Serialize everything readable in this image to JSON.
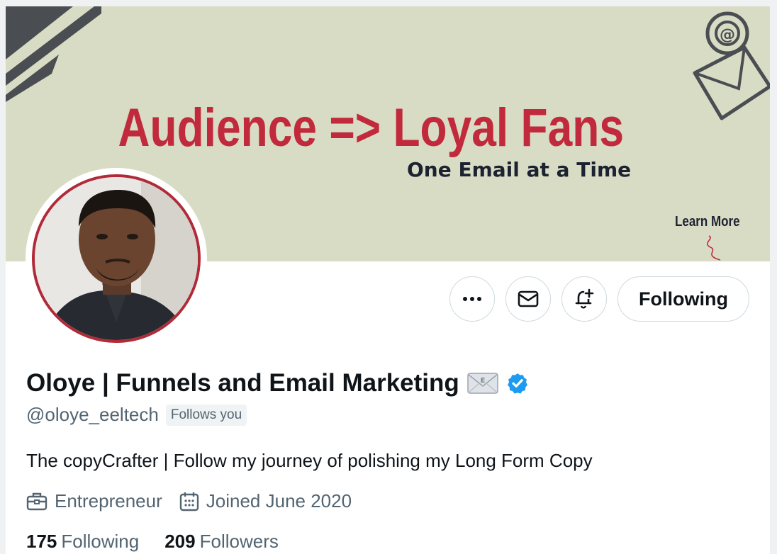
{
  "banner": {
    "headline": "Audience => Loyal Fans",
    "subline": "One Email at a Time",
    "cta": "Learn More",
    "accent_color": "#c12a3c",
    "background_color": "#d9dcc4"
  },
  "profile": {
    "display_name": "Oloye | Funnels and Email Marketing",
    "name_emoji": "envelope-emoji",
    "verified": true,
    "verified_color": "#1d9bf0",
    "handle": "@oloye_eeltech",
    "follows_you": "Follows you",
    "bio": "The copyCrafter | Follow my journey of polishing my Long Form Copy",
    "category": "Entrepreneur",
    "joined": "Joined June 2020",
    "stats": {
      "following_count": "175",
      "following_label": "Following",
      "followers_count": "209",
      "followers_label": "Followers"
    }
  },
  "actions": {
    "more_icon": "more-icon",
    "message_icon": "envelope-icon",
    "notify_icon": "bell-plus-icon",
    "follow_button_label": "Following"
  }
}
